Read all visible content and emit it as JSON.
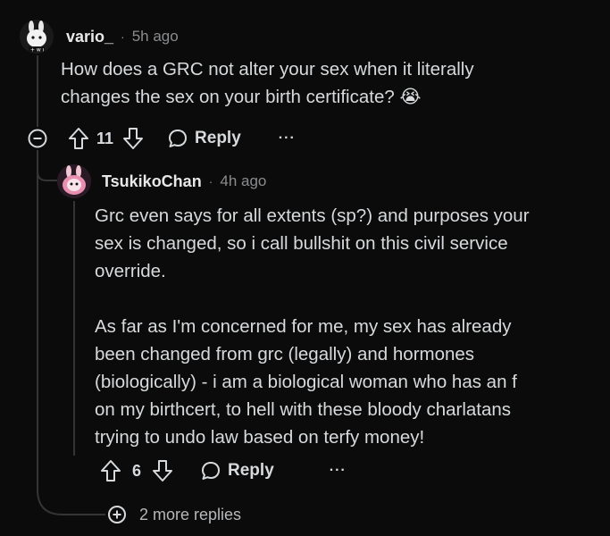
{
  "comments": [
    {
      "username": "vario_",
      "separator": "·",
      "time": "5h ago",
      "paragraphs": [
        "How does a GRC not alter your sex when it literally changes the sex on your birth certificate? 😭"
      ],
      "lines": [
        "How does a GRC not alter your sex when it literally",
        "changes the sex on your birth certificate? 😭"
      ],
      "votes": "11",
      "reply_label": "Reply",
      "more_label": "···"
    },
    {
      "username": "TsukikoChan",
      "separator": "·",
      "time": "4h ago",
      "para1_lines": [
        "Grc even says for all extents (sp?) and purposes your",
        "sex is changed, so i call bullshit on this civil service",
        "override."
      ],
      "para2_lines": [
        "As far as I'm concerned for me, my sex has already",
        "been changed from grc (legally) and hormones",
        "(biologically) - i am a biological woman who has an f",
        "on my birthcert, to hell with these bloody charlatans",
        "trying to undo law based on terfy money!"
      ],
      "votes": "6",
      "reply_label": "Reply",
      "more_label": "···"
    }
  ],
  "more_replies_label": "2 more replies",
  "colors": {
    "background": "#0b0b0b",
    "text": "#d7dadc",
    "muted": "#8a8c8e",
    "thread_line": "#343536"
  }
}
